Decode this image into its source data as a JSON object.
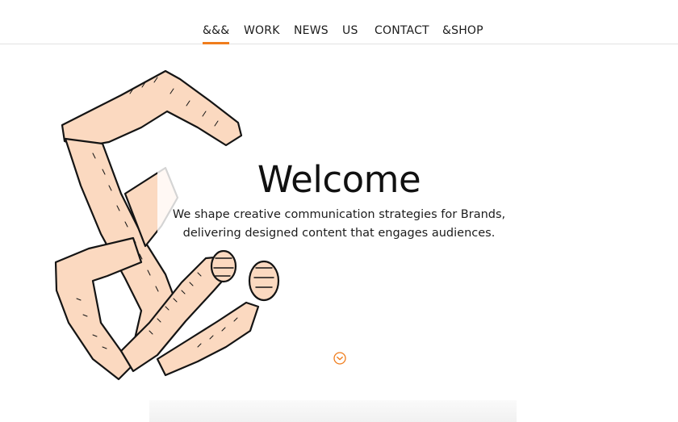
{
  "nav": {
    "items": [
      {
        "label": "&&&",
        "active": true
      },
      {
        "label": "WORK",
        "active": false
      },
      {
        "label": "NEWS",
        "active": false
      },
      {
        "label": "US",
        "active": false
      },
      {
        "label": "CONTACT",
        "active": false
      },
      {
        "label": "&SHOP",
        "active": false
      }
    ]
  },
  "hero": {
    "title": "Welcome",
    "subtitle_line1": "We shape creative communication strategies for Brands,",
    "subtitle_line2": "delivering designed content that engages audiences.",
    "illustration": "ampersand-arms-illustration",
    "scroll_icon": "chevron-down-circle-icon"
  },
  "colors": {
    "accent": "#f07d1c",
    "skin": "#fbd9c0",
    "ink": "#141414",
    "text": "#1c1c1c",
    "divider": "#e2e2e2"
  }
}
